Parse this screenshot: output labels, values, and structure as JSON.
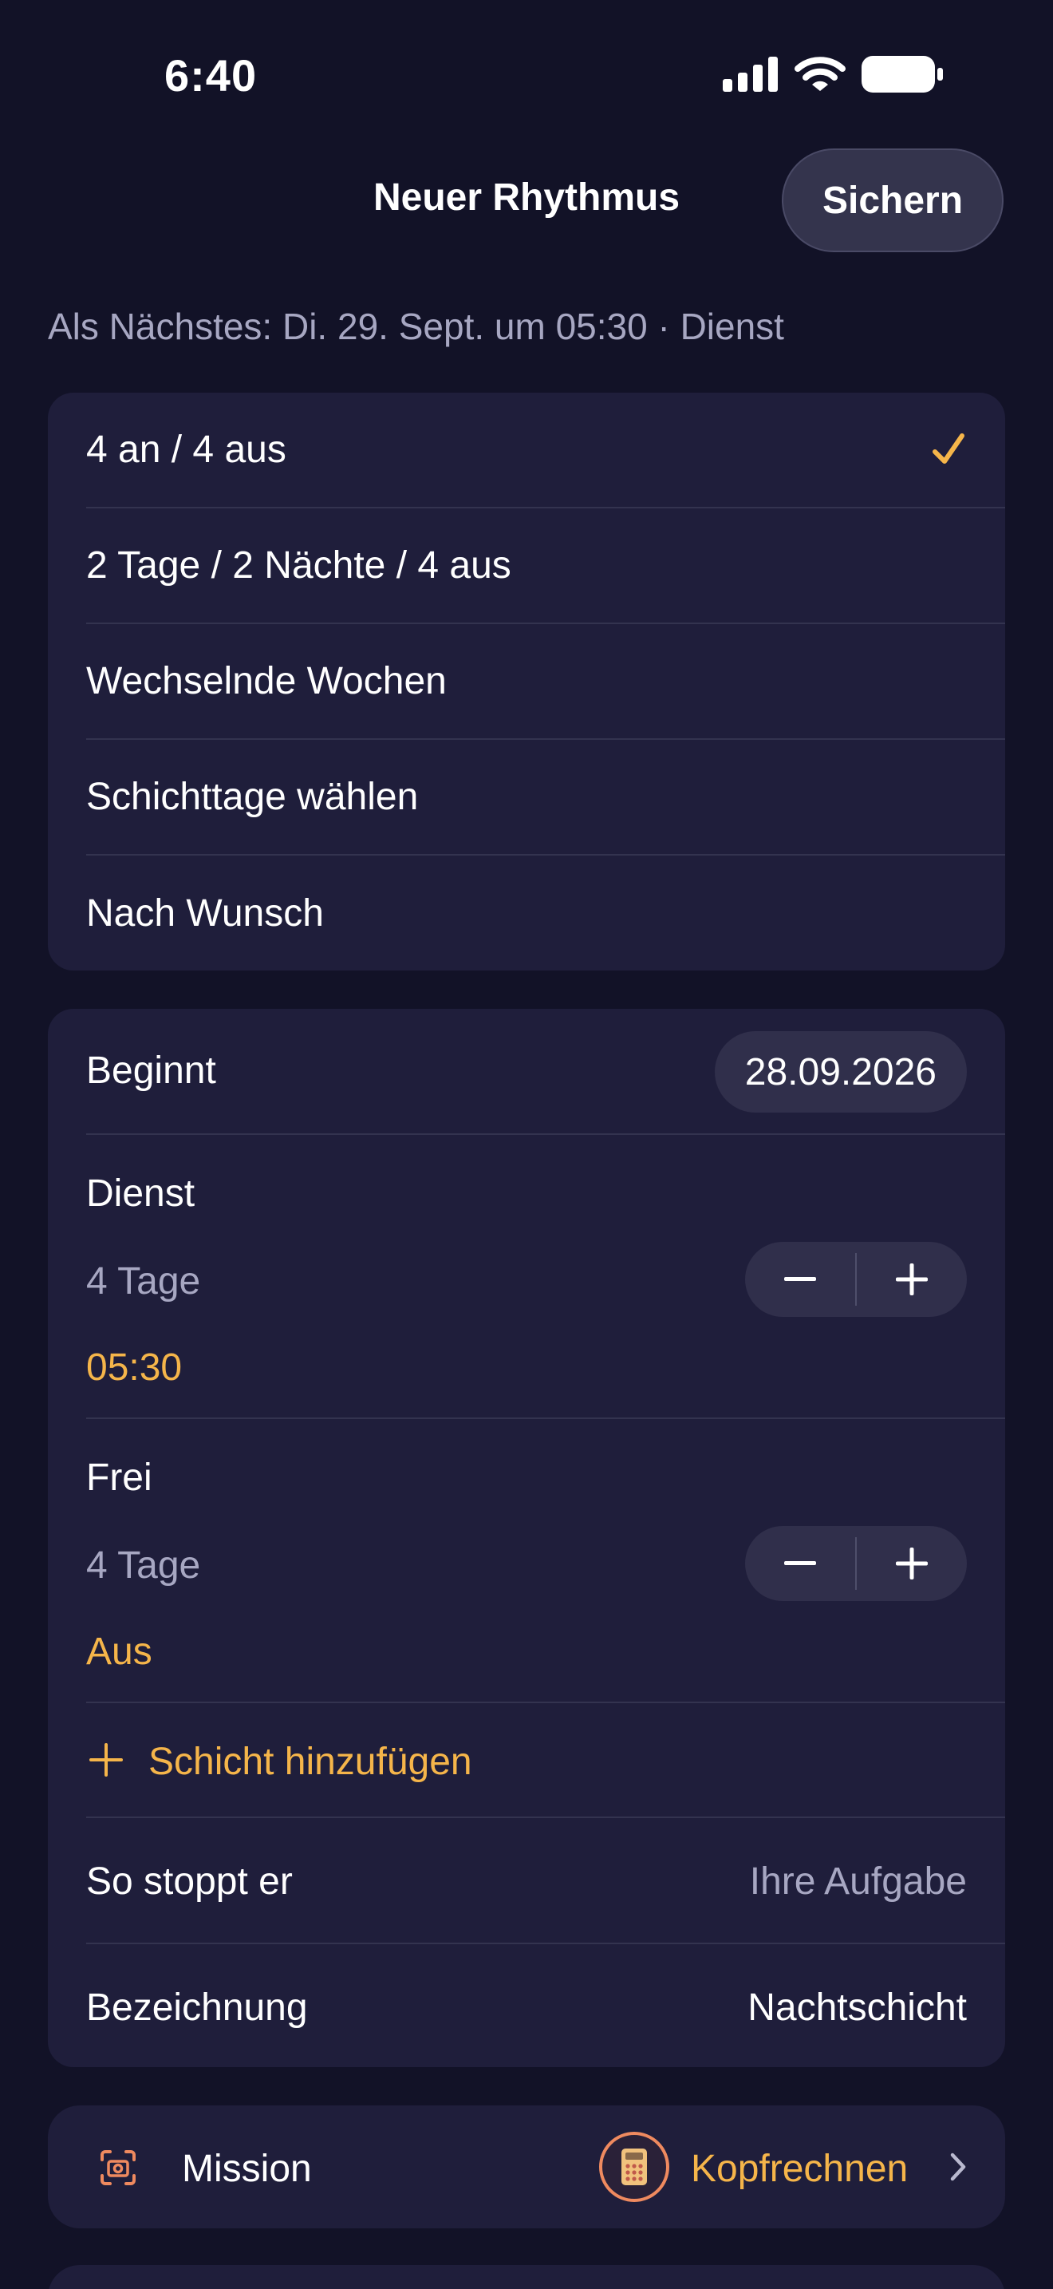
{
  "status_bar": {
    "time": "6:40"
  },
  "nav": {
    "title": "Neuer Rhythmus",
    "save_label": "Sichern"
  },
  "next_info": "Als Nächstes: Di. 29. Sept. um 05:30 · Dienst",
  "patterns": {
    "selected_index": 0,
    "items": [
      {
        "label": "4 an / 4 aus"
      },
      {
        "label": "2 Tage / 2 Nächte / 4 aus"
      },
      {
        "label": "Wechselnde Wochen"
      },
      {
        "label": "Schichttage wählen"
      },
      {
        "label": "Nach Wunsch"
      }
    ]
  },
  "settings": {
    "start_label": "Beginnt",
    "start_date": "28.09.2026",
    "shifts": [
      {
        "name": "Dienst",
        "duration": "4 Tage",
        "time": "05:30"
      },
      {
        "name": "Frei",
        "duration": "4 Tage",
        "time": "Aus"
      }
    ],
    "add_shift_label": "Schicht hinzufügen",
    "stop_label": "So stoppt er",
    "stop_value": "Ihre Aufgabe",
    "name_label": "Bezeichnung",
    "name_value": "Nachtschicht"
  },
  "mission": {
    "label": "Mission",
    "value": "Kopfrechnen"
  },
  "colors": {
    "accent": "#f5b54a",
    "mission_icon": "#ef8a5f",
    "background": "#121227",
    "card": "#1f1e3b"
  }
}
